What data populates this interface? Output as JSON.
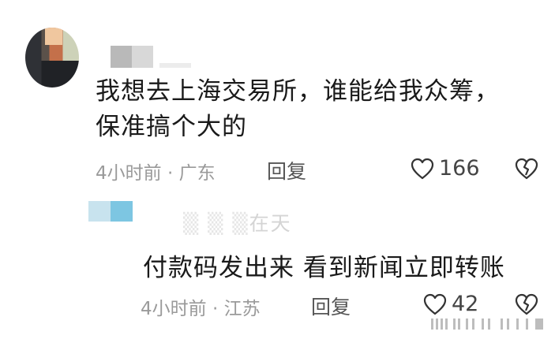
{
  "comment": {
    "text_line1": "我想去上海交易所，谁能给我众筹，",
    "text_line2": "保准搞个大的",
    "time": "4小时前",
    "location": "广东",
    "reply_label": "回复",
    "likes": "166"
  },
  "reply": {
    "name_visible_fragment": "在天",
    "text": "付款码发出来  看到新闻立即转账",
    "time": "4小时前",
    "location": "江苏",
    "reply_label": "回复",
    "likes": "42"
  },
  "icons": {
    "like": "heart-outline-icon",
    "dislike": "broken-heart-icon"
  },
  "colors": {
    "meta_gray": "#9a9a9a",
    "text": "#1a1a1a"
  }
}
